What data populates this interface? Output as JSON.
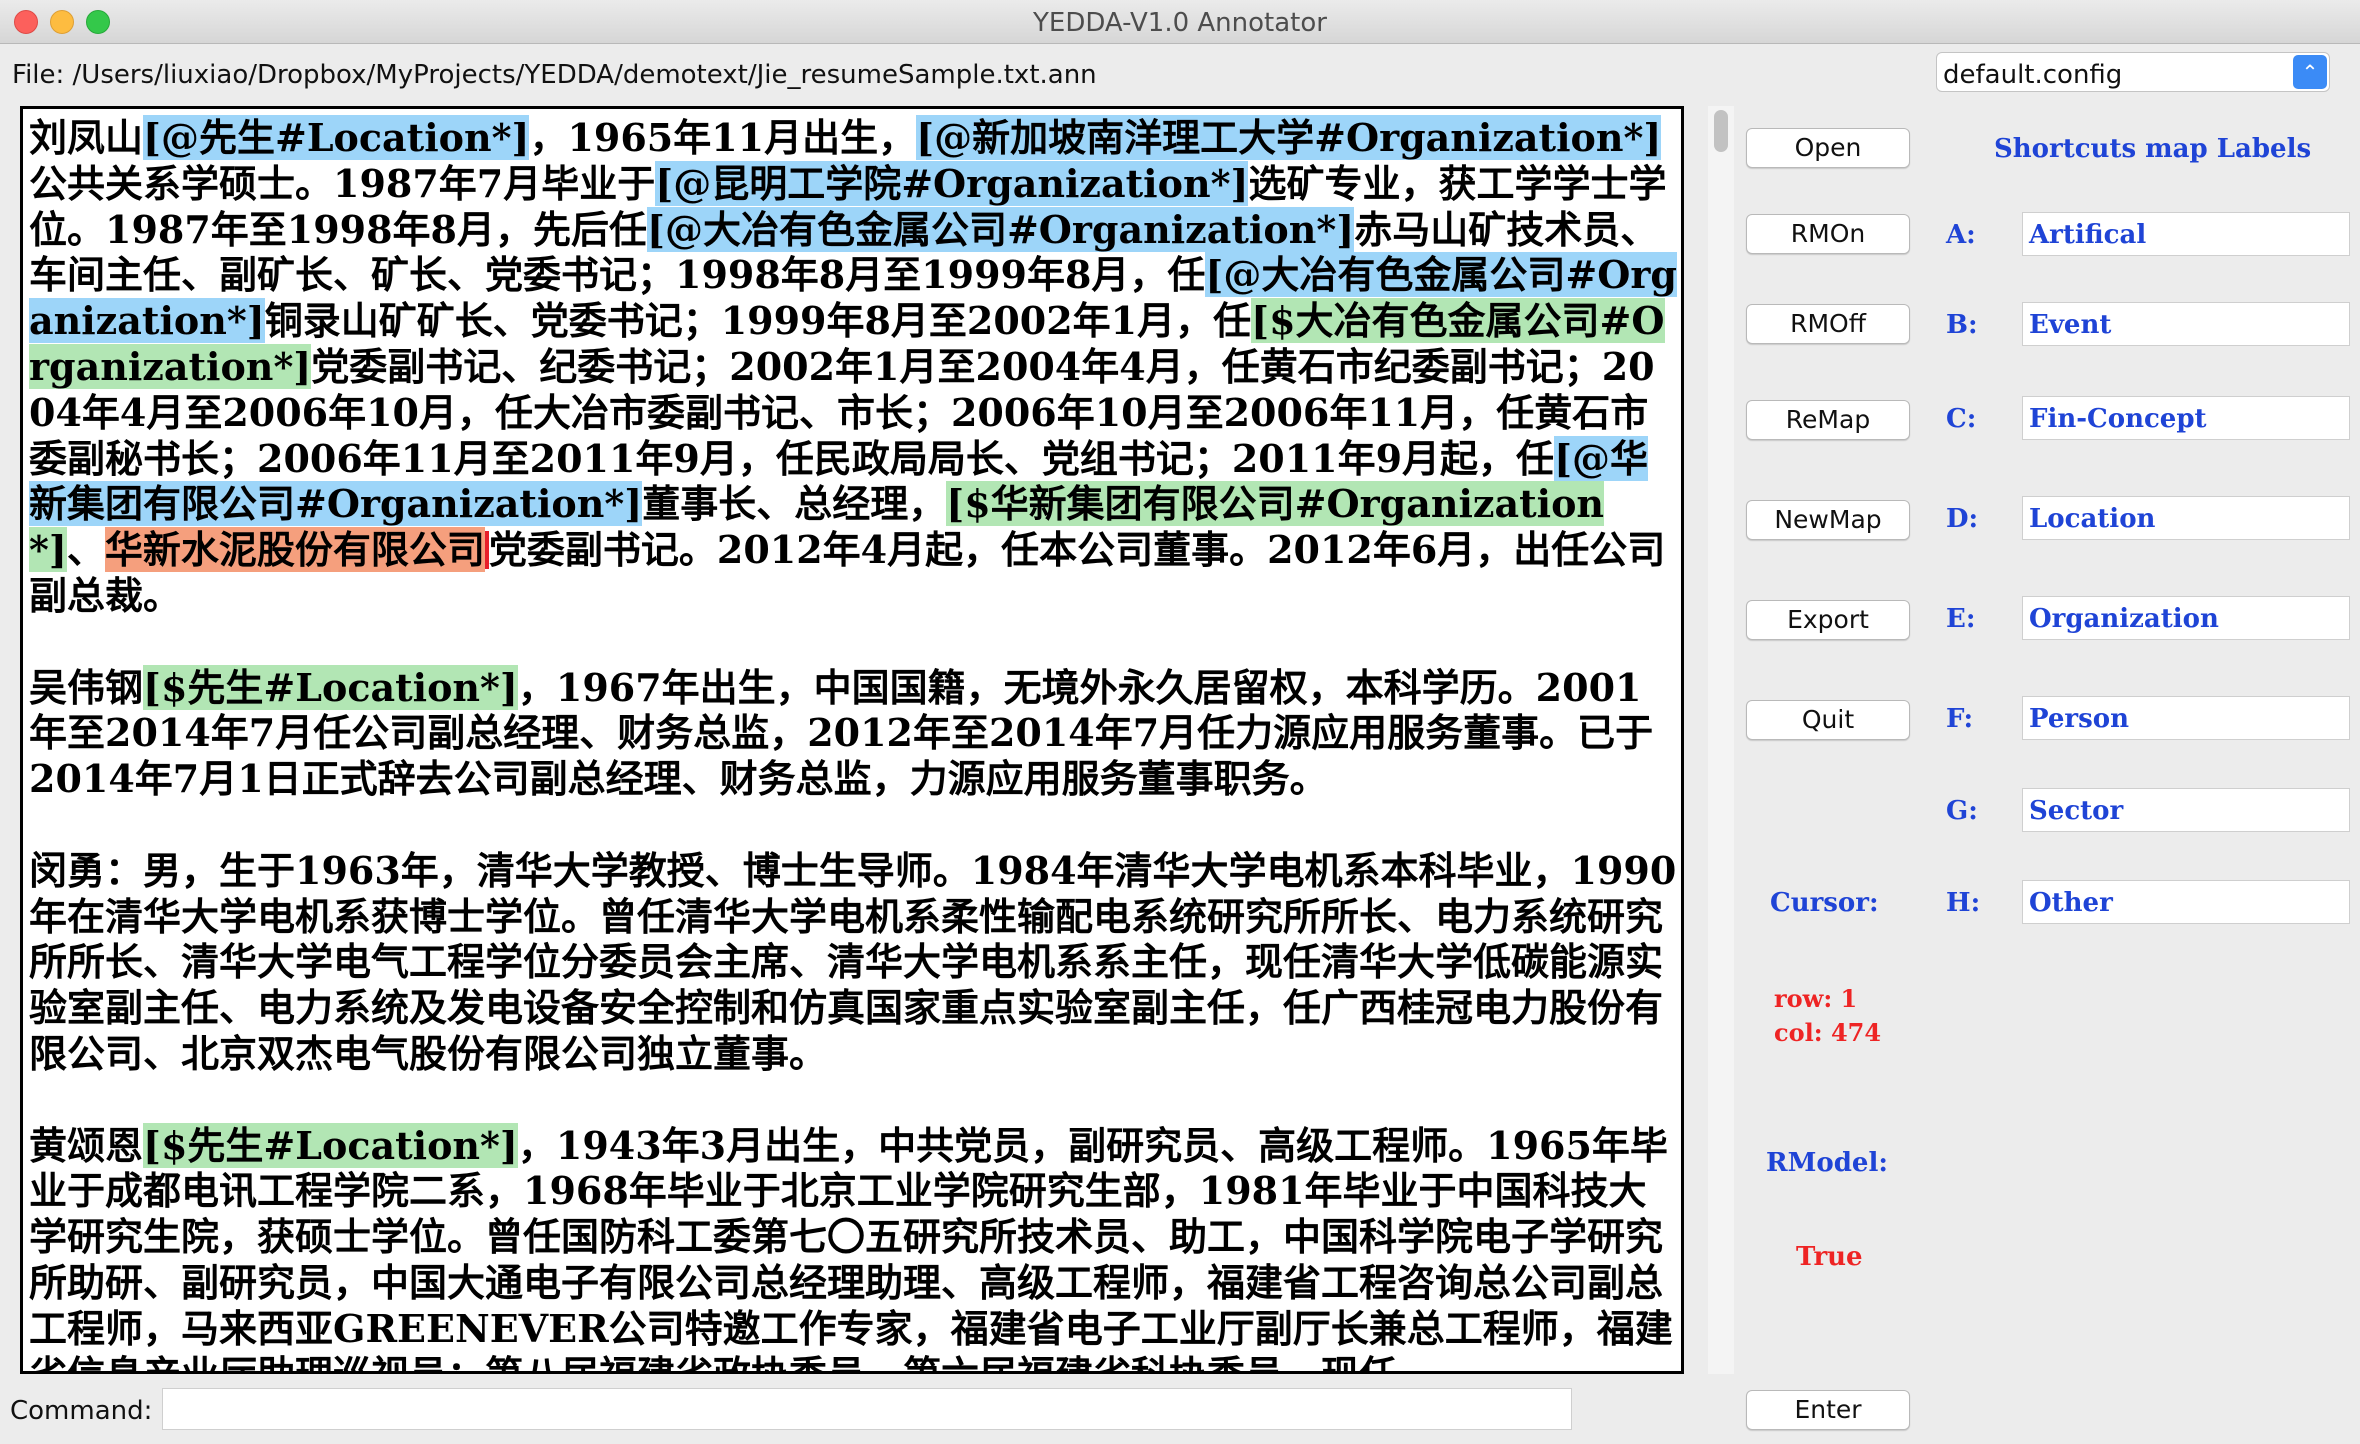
{
  "window": {
    "title": "YEDDA-V1.0 Annotator"
  },
  "file": {
    "label": "File: /Users/liuxiao/Dropbox/MyProjects/YEDDA/demotext/Jie_resumeSample.txt.ann"
  },
  "config": {
    "selected": "default.config"
  },
  "text": {
    "p1": {
      "s1": "刘凤山",
      "t1": "[@先生#Location*]",
      "s2": "，1965年11月出生，",
      "t2": "[@新加坡南洋理工大学#Organization*]",
      "s3": "公共关系学硕士。1987年7月毕业于",
      "t3": "[@昆明工学院#Organization*]",
      "s4": "选矿专业，获工学学士学位。1987年至1998年8月，先后任",
      "t4": "[@大冶有色金属公司#Organization*]",
      "s5": "赤马山矿技术员、车间主任、副矿长、矿长、党委书记；1998年8月至1999年8月，任",
      "t5": "[@大冶有色金属公司#Organization*]",
      "s6": "铜录山矿矿长、党委书记；1999年8月至2002年1月，任",
      "t6": "[$大冶有色金属公司#Organization*]",
      "s7": "党委副书记、纪委书记；2002年1月至2004年4月，任黄石市纪委副书记；2004年4月至2006年10月，任大冶市委副书记、市长；2006年10月至2006年11月，任黄石市委副秘书长；2006年11月至2011年9月，任民政局局长、党组书记；2011年9月起，任",
      "t7": "[@华新集团有限公司#Organization*]",
      "s8": "董事长、总经理，",
      "t8": "[$华新集团有限公司#Organization*]",
      "s9": "、",
      "t9": "华新水泥股份有限公司",
      "s10": "党委副书记。2012年4月起，任本公司董事。2012年6月，出任公司副总裁。"
    },
    "p2": {
      "s1": "吴伟钢",
      "t1": "[$先生#Location*]",
      "s2": "，1967年出生，中国国籍，无境外永久居留权，本科学历。2001年至2014年7月任公司副总经理、财务总监，2012年至2014年7月任力源应用服务董事。已于2014年7月1日正式辞去公司副总经理、财务总监，力源应用服务董事职务。"
    },
    "p3": "闵勇：男，生于1963年，清华大学教授、博士生导师。1984年清华大学电机系本科毕业，1990年在清华大学电机系获博士学位。曾任清华大学电机系柔性输配电系统研究所所长、电力系统研究所所长、清华大学电气工程学位分委员会主席、清华大学电机系系主任，现任清华大学低碳能源实验室副主任、电力系统及发电设备安全控制和仿真国家重点实验室副主任，任广西桂冠电力股份有限公司、北京双杰电气股份有限公司独立董事。",
    "p4": {
      "s1": "黄颂恩",
      "t1": "[$先生#Location*]",
      "s2": "，1943年3月出生，中共党员，副研究员、高级工程师。1965年毕业于成都电讯工程学院二系，1968年毕业于北京工业学院研究生部，1981年毕业于中国科技大学研究生院，获硕士学位。曾任国防科工委第七〇五研究所技术员、助工，中国科学院电子学研究所助研、副研究员，中国大通电子有限公司总经理助理、高级工程师，福建省工程咨询总公司副总工程师，马来西亚GREENEVER公司特邀工作专家，福建省电子工业厅副厅长兼总工程师，福建省信息产业厅助理巡视员；第八届福建省政协委员、第六届福建省科协委员。现任"
    }
  },
  "buttons": {
    "open": "Open",
    "rmon": "RMOn",
    "rmoff": "RMOff",
    "remap": "ReMap",
    "newmap": "NewMap",
    "export": "Export",
    "quit": "Quit",
    "enter": "Enter"
  },
  "shortcuts": {
    "title": "Shortcuts map Labels",
    "items": [
      {
        "key": "A:",
        "label": "Artifical"
      },
      {
        "key": "B:",
        "label": "Event"
      },
      {
        "key": "C:",
        "label": "Fin-Concept"
      },
      {
        "key": "D:",
        "label": "Location"
      },
      {
        "key": "E:",
        "label": "Organization"
      },
      {
        "key": "F:",
        "label": "Person"
      },
      {
        "key": "G:",
        "label": "Sector"
      },
      {
        "key": "H:",
        "label": "Other"
      }
    ]
  },
  "cursor": {
    "label": "Cursor:",
    "row": "row: 1",
    "col": "col: 474"
  },
  "rmodel": {
    "label": "RModel:",
    "value": "True"
  },
  "command": {
    "label": "Command:",
    "value": ""
  },
  "colors": {
    "org_tag": "#9dd5f9",
    "loc_tag": "#b2e6b4",
    "recommend_tag": "#f59f7d",
    "label_blue": "#1f44d6",
    "status_red": "#ee2424"
  }
}
